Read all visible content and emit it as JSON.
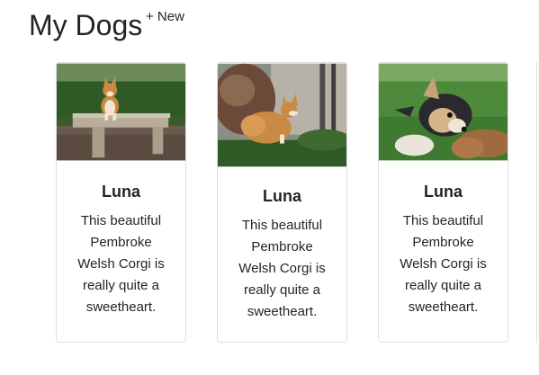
{
  "header": {
    "title": "My Dogs",
    "new_link": "+ New"
  },
  "cards": [
    {
      "name": "Luna",
      "description": "This beautiful Pembroke Welsh Corgi is really quite a sweetheart.",
      "photo": "corgi-on-bench"
    },
    {
      "name": "Luna",
      "description": "This beautiful Pembroke Welsh Corgi is really quite a sweetheart.",
      "photo": "corgi-in-garden"
    },
    {
      "name": "Luna",
      "description": "This beautiful Pembroke Welsh Corgi is really quite a sweetheart.",
      "photo": "corgi-puppy-on-grass"
    }
  ],
  "colors": {
    "text": "#212529",
    "card_border": "#dfdfdf"
  }
}
